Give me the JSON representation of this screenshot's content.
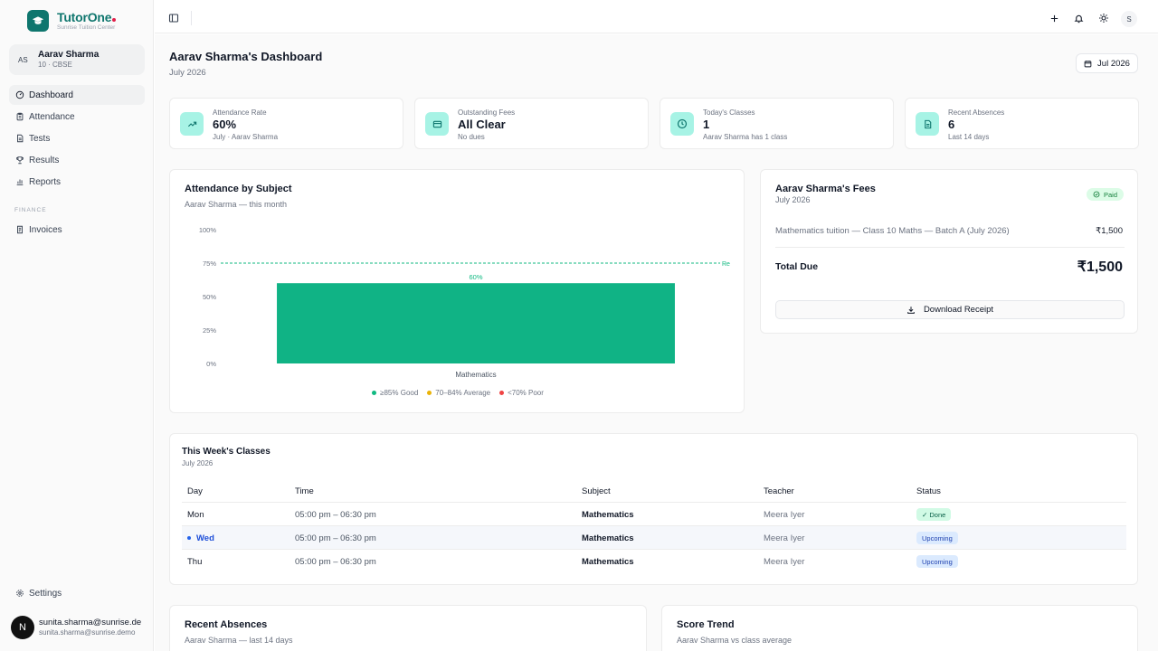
{
  "brand": {
    "name": "TutorOne",
    "subtitle": "Sunrise Tuition Center"
  },
  "student": {
    "initials": "AS",
    "name": "Aarav Sharma",
    "meta": "10 · CBSE"
  },
  "nav": {
    "items": [
      {
        "label": "Dashboard",
        "icon": "dashboard-icon",
        "active": true
      },
      {
        "label": "Attendance",
        "icon": "clipboard-icon"
      },
      {
        "label": "Tests",
        "icon": "document-icon"
      },
      {
        "label": "Results",
        "icon": "trophy-icon"
      },
      {
        "label": "Reports",
        "icon": "bar-chart-icon"
      }
    ],
    "section": "FINANCE",
    "finance_items": [
      {
        "label": "Invoices",
        "icon": "invoice-icon"
      }
    ],
    "settings": "Settings"
  },
  "account": {
    "initial": "N",
    "name": "sunita.sharma@sunrise.de",
    "email": "sunita.sharma@sunrise.demo"
  },
  "topbar": {
    "avatar": "S"
  },
  "page": {
    "title": "Aarav Sharma's Dashboard",
    "subtitle": "July 2026",
    "month_button": "Jul 2026"
  },
  "stats": [
    {
      "label": "Attendance Rate",
      "value": "60%",
      "sub": "July · Aarav Sharma",
      "icon": "trending-up-icon"
    },
    {
      "label": "Outstanding Fees",
      "value": "All Clear",
      "sub": "No dues",
      "icon": "credit-card-icon"
    },
    {
      "label": "Today's Classes",
      "value": "1",
      "sub": "Aarav Sharma has 1 class",
      "icon": "clock-icon"
    },
    {
      "label": "Recent Absences",
      "value": "6",
      "sub": "Last 14 days",
      "icon": "file-text-icon"
    }
  ],
  "attendance_card": {
    "title": "Attendance by Subject",
    "subtitle": "Aarav Sharma — this month"
  },
  "chart_data": {
    "type": "bar",
    "categories": [
      "Mathematics"
    ],
    "values": [
      60
    ],
    "data_labels": [
      "60%"
    ],
    "ylim": [
      0,
      100
    ],
    "yticks": [
      "0%",
      "25%",
      "50%",
      "75%",
      "100%"
    ],
    "reference_line": {
      "value": 75,
      "label": "Re"
    },
    "bar_color": "#10b385",
    "grid": false,
    "legend": [
      {
        "label": "≥85% Good",
        "color": "#10b981"
      },
      {
        "label": "70–84% Average",
        "color": "#eab308"
      },
      {
        "label": "<70% Poor",
        "color": "#ef4444"
      }
    ],
    "legend_position": "bottom"
  },
  "fees": {
    "title": "Aarav Sharma's Fees",
    "subtitle": "July 2026",
    "badge": "Paid",
    "line_item": "Mathematics tuition — Class 10 Maths — Batch A (July 2026)",
    "line_amount": "₹1,500",
    "total_label": "Total Due",
    "total_amount": "₹1,500",
    "download_label": "Download Receipt"
  },
  "classes": {
    "title": "This Week's Classes",
    "subtitle": "July 2026",
    "headers": [
      "Day",
      "Time",
      "Subject",
      "Teacher",
      "Status"
    ],
    "rows": [
      {
        "day": "Mon",
        "time": "05:00 pm – 06:30 pm",
        "subject": "Mathematics",
        "teacher": "Meera Iyer",
        "status": "✓ Done"
      },
      {
        "day": "Wed",
        "time": "05:00 pm – 06:30 pm",
        "subject": "Mathematics",
        "teacher": "Meera Iyer",
        "status": "Upcoming"
      },
      {
        "day": "Thu",
        "time": "05:00 pm – 06:30 pm",
        "subject": "Mathematics",
        "teacher": "Meera Iyer",
        "status": "Upcoming"
      }
    ]
  },
  "absences_card": {
    "title": "Recent Absences",
    "subtitle": "Aarav Sharma — last 14 days"
  },
  "score_card": {
    "title": "Score Trend",
    "subtitle": "Aarav Sharma vs class average"
  }
}
